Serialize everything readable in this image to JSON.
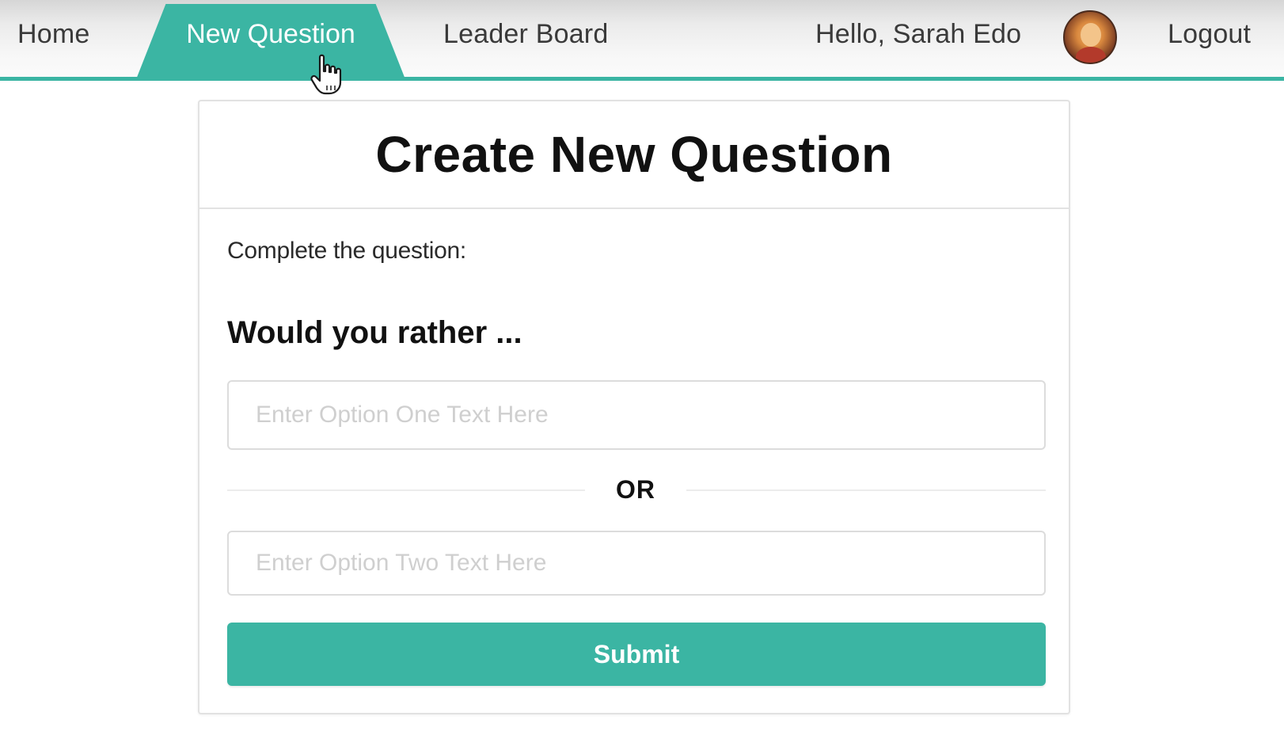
{
  "nav": {
    "home": "Home",
    "new_question": "New Question",
    "leader_board": "Leader Board",
    "greeting": "Hello, Sarah Edo",
    "logout": "Logout",
    "active_tab": "New Question"
  },
  "card": {
    "title": "Create New Question",
    "instruction": "Complete the question:",
    "lead": "Would you rather ...",
    "option_one": {
      "value": "",
      "placeholder": "Enter Option One Text Here"
    },
    "separator": "OR",
    "option_two": {
      "value": "",
      "placeholder": "Enter Option Two Text Here"
    },
    "submit_label": "Submit"
  },
  "colors": {
    "accent": "#3bb5a3",
    "text": "#111111",
    "muted_placeholder": "#cfcfcf",
    "border": "#e2e2e2"
  },
  "icons": {
    "avatar": "avatar",
    "cursor": "hand-pointer-icon"
  }
}
